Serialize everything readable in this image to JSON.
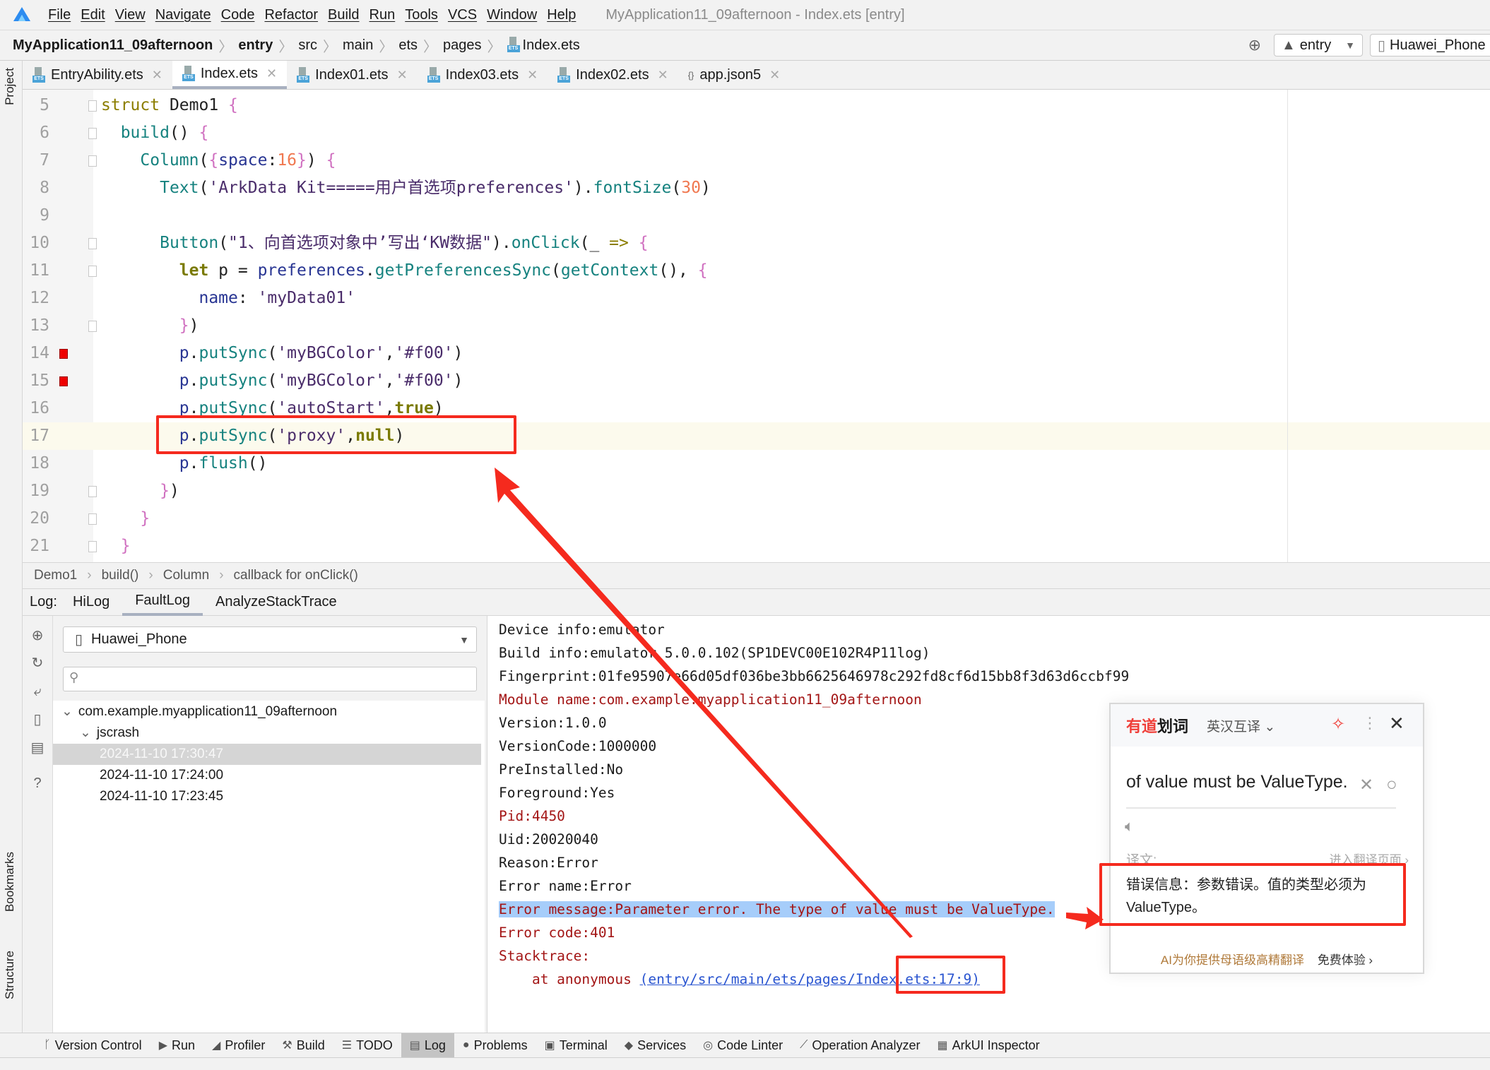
{
  "menu": {
    "items": [
      "File",
      "Edit",
      "View",
      "Navigate",
      "Code",
      "Refactor",
      "Build",
      "Run",
      "Tools",
      "VCS",
      "Window",
      "Help"
    ],
    "window_title": "MyApplication11_09afternoon - Index.ets [entry]"
  },
  "nav": {
    "crumbs": [
      "MyApplication11_09afternoon",
      "entry",
      "src",
      "main",
      "ets",
      "pages",
      "Index.ets"
    ],
    "module_select": "entry",
    "device_select": "Huawei_Phone"
  },
  "tabs": [
    {
      "label": "EntryAbility.ets",
      "icon": "ets-file-icon"
    },
    {
      "label": "Index.ets",
      "icon": "ets-file-icon",
      "active": true
    },
    {
      "label": "Index01.ets",
      "icon": "ets-file-icon"
    },
    {
      "label": "Index03.ets",
      "icon": "ets-file-icon"
    },
    {
      "label": "Index02.ets",
      "icon": "ets-file-icon"
    },
    {
      "label": "app.json5",
      "icon": "json-file-icon"
    }
  ],
  "side_labels": {
    "project": "Project",
    "bookmarks": "Bookmarks",
    "structure": "Structure"
  },
  "editor": {
    "current_line": 17,
    "lines": [
      {
        "n": "5",
        "fold": true,
        "t": [
          [
            "kw",
            "struct"
          ],
          [
            "pl",
            " Demo1 "
          ],
          [
            "br",
            "{"
          ]
        ]
      },
      {
        "n": "6",
        "fold": true,
        "t": [
          [
            "pl",
            "  "
          ],
          [
            "fn",
            "build"
          ],
          [
            "pl",
            "() "
          ],
          [
            "br",
            "{"
          ]
        ]
      },
      {
        "n": "7",
        "fold": true,
        "t": [
          [
            "pl",
            "    "
          ],
          [
            "fn",
            "Column"
          ],
          [
            "pl",
            "("
          ],
          [
            "br",
            "{"
          ],
          [
            "pr",
            "space"
          ],
          [
            "pl",
            ":"
          ],
          [
            "nu",
            "16"
          ],
          [
            "br",
            "}"
          ],
          [
            "pl",
            ") "
          ],
          [
            "br",
            "{"
          ]
        ]
      },
      {
        "n": "8",
        "t": [
          [
            "pl",
            "      "
          ],
          [
            "fn",
            "Text"
          ],
          [
            "pl",
            "("
          ],
          [
            "st",
            "'ArkData Kit=====用户首选项preferences'"
          ],
          [
            "pl",
            ")."
          ],
          [
            "fn",
            "fontSize"
          ],
          [
            "pl",
            "("
          ],
          [
            "nu",
            "30"
          ],
          [
            "pl",
            ")"
          ]
        ]
      },
      {
        "n": "9",
        "t": []
      },
      {
        "n": "10",
        "fold": true,
        "t": [
          [
            "pl",
            "      "
          ],
          [
            "fn",
            "Button"
          ],
          [
            "pl",
            "("
          ],
          [
            "st",
            "\"1、向首选项对象中’写出‘KW数据\""
          ],
          [
            "pl",
            ")."
          ],
          [
            "fn",
            "onClick"
          ],
          [
            "pl",
            "(_ "
          ],
          [
            "kw",
            "=>"
          ],
          [
            "pl",
            " "
          ],
          [
            "br",
            "{"
          ]
        ]
      },
      {
        "n": "11",
        "fold": true,
        "t": [
          [
            "pl",
            "        "
          ],
          [
            "bo",
            "let"
          ],
          [
            "pl",
            " p = "
          ],
          [
            "pr",
            "preferences"
          ],
          [
            "pl",
            "."
          ],
          [
            "fn",
            "getPreferencesSync"
          ],
          [
            "pl",
            "("
          ],
          [
            "fn",
            "getContext"
          ],
          [
            "pl",
            "(), "
          ],
          [
            "br",
            "{"
          ]
        ]
      },
      {
        "n": "12",
        "t": [
          [
            "pl",
            "          "
          ],
          [
            "pr",
            "name"
          ],
          [
            "pl",
            ": "
          ],
          [
            "st",
            "'myData01'"
          ]
        ]
      },
      {
        "n": "13",
        "fold": true,
        "t": [
          [
            "pl",
            "        "
          ],
          [
            "br",
            "}"
          ],
          [
            "pl",
            ")"
          ]
        ]
      },
      {
        "n": "14",
        "bp": true,
        "t": [
          [
            "pl",
            "        "
          ],
          [
            "pr",
            "p"
          ],
          [
            "pl",
            "."
          ],
          [
            "fn",
            "putSync"
          ],
          [
            "pl",
            "("
          ],
          [
            "st",
            "'myBGColor'"
          ],
          [
            "pl",
            ","
          ],
          [
            "st",
            "'#f00'"
          ],
          [
            "pl",
            ")"
          ]
        ]
      },
      {
        "n": "15",
        "bp": true,
        "t": [
          [
            "pl",
            "        "
          ],
          [
            "pr",
            "p"
          ],
          [
            "pl",
            "."
          ],
          [
            "fn",
            "putSync"
          ],
          [
            "pl",
            "("
          ],
          [
            "st",
            "'myBGColor'"
          ],
          [
            "pl",
            ","
          ],
          [
            "st",
            "'#f00'"
          ],
          [
            "pl",
            ")"
          ]
        ]
      },
      {
        "n": "16",
        "t": [
          [
            "pl",
            "        "
          ],
          [
            "pr",
            "p"
          ],
          [
            "pl",
            "."
          ],
          [
            "fn",
            "putSync"
          ],
          [
            "pl",
            "("
          ],
          [
            "st",
            "'autoStart'"
          ],
          [
            "pl",
            ","
          ],
          [
            "bo",
            "true"
          ],
          [
            "pl",
            ")"
          ]
        ]
      },
      {
        "n": "17",
        "t": [
          [
            "pl",
            "        "
          ],
          [
            "pr",
            "p"
          ],
          [
            "pl",
            "."
          ],
          [
            "fn",
            "putSync"
          ],
          [
            "pl",
            "("
          ],
          [
            "st",
            "'proxy'"
          ],
          [
            "pl",
            ","
          ],
          [
            "bo",
            "null"
          ],
          [
            "pl",
            ")"
          ]
        ]
      },
      {
        "n": "18",
        "t": [
          [
            "pl",
            "        "
          ],
          [
            "pr",
            "p"
          ],
          [
            "pl",
            "."
          ],
          [
            "fn",
            "flush"
          ],
          [
            "pl",
            "()"
          ]
        ]
      },
      {
        "n": "19",
        "fold": true,
        "t": [
          [
            "pl",
            "      "
          ],
          [
            "br",
            "}"
          ],
          [
            "pl",
            ")"
          ]
        ]
      },
      {
        "n": "20",
        "fold": true,
        "t": [
          [
            "pl",
            "    "
          ],
          [
            "br",
            "}"
          ]
        ]
      },
      {
        "n": "21",
        "fold": true,
        "t": [
          [
            "pl",
            "  "
          ],
          [
            "br",
            "}"
          ]
        ]
      }
    ]
  },
  "editor_breadcrumb": [
    "Demo1",
    "build()",
    "Column",
    "callback for onClick()"
  ],
  "log": {
    "label": "Log:",
    "tabs": [
      "HiLog",
      "FaultLog",
      "AnalyzeStackTrace"
    ],
    "active_tab": "FaultLog",
    "device": "Huawei_Phone",
    "search_placeholder": "",
    "tree": {
      "package": "com.example.myapplication11_09afternoon",
      "group": "jscrash",
      "entries": [
        "2024-11-10 17:30:47",
        "2024-11-10 17:24:00",
        "2024-11-10 17:23:45"
      ],
      "selected": 0
    },
    "lines": [
      {
        "text": "Device info:emulator"
      },
      {
        "text": "Build info:emulator 5.0.0.102(SP1DEVC00E102R4P11log)"
      },
      {
        "text": "Fingerprint:01fe95907e66d05df036be3bb6625646978c292fd8cf6d15bb8f3d63d6ccbf99"
      },
      {
        "text": "Module name:com.example.myapplication11_09afternoon",
        "red": true
      },
      {
        "text": "Version:1.0.0"
      },
      {
        "text": "VersionCode:1000000"
      },
      {
        "text": "PreInstalled:No"
      },
      {
        "text": "Foreground:Yes"
      },
      {
        "text": "Pid:4450",
        "red": true
      },
      {
        "text": "Uid:20020040"
      },
      {
        "text": "Reason:Error"
      },
      {
        "text": "Error name:Error"
      },
      {
        "text": "Error message:Parameter error. The type of value must be ValueType.",
        "red": true,
        "highlight": true
      },
      {
        "text": "Error code:401",
        "red": true
      },
      {
        "text": "Stacktrace:",
        "red": true
      },
      {
        "text": "    at anonymous ",
        "red": true,
        "link": "(entry/src/main/ets/pages/Index.ets:17:9)"
      }
    ]
  },
  "bottom_tools": [
    {
      "label": "Version Control",
      "icon": "version-control-icon"
    },
    {
      "label": "Run",
      "icon": "run-icon"
    },
    {
      "label": "Profiler",
      "icon": "profiler-icon"
    },
    {
      "label": "Build",
      "icon": "build-icon"
    },
    {
      "label": "TODO",
      "icon": "todo-icon"
    },
    {
      "label": "Log",
      "icon": "log-icon",
      "active": true
    },
    {
      "label": "Problems",
      "icon": "problems-icon"
    },
    {
      "label": "Terminal",
      "icon": "terminal-icon"
    },
    {
      "label": "Services",
      "icon": "services-icon"
    },
    {
      "label": "Code Linter",
      "icon": "code-linter-icon"
    },
    {
      "label": "Operation Analyzer",
      "icon": "operation-analyzer-icon"
    },
    {
      "label": "ArkUI Inspector",
      "icon": "arkui-inspector-icon"
    }
  ],
  "youdao": {
    "brand_red": "有道",
    "brand": "划词",
    "mode": "英汉互译",
    "query": "of value must be ValueType.",
    "translation_label": "译文:",
    "open_page": "进入翻译页面",
    "translation": "错误信息：参数错误。值的类型必须为ValueType。",
    "ai_promo": "AI为你提供母语级高精翻译",
    "try_free": "免费体验"
  },
  "colors": {
    "annotation_red": "#f52a1e",
    "selection": "#a6cdfa",
    "current_line": "#fcfaed",
    "error_text": "#a31515",
    "link": "#2a55d0"
  }
}
